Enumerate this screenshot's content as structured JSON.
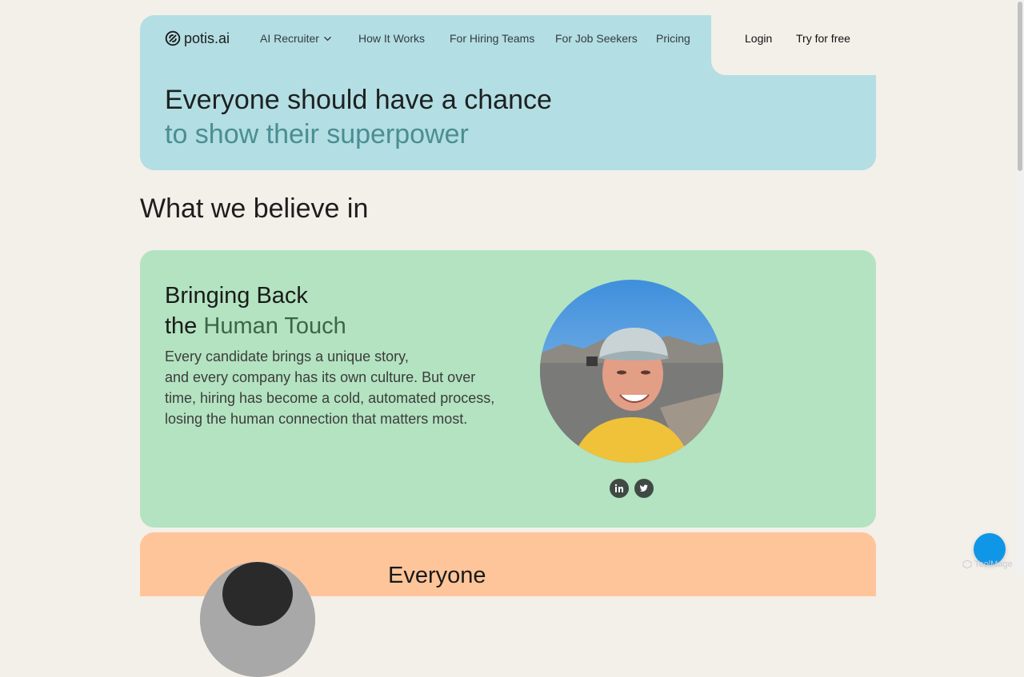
{
  "brand": {
    "name": "potis.ai",
    "icon": "potis-logo-icon"
  },
  "nav": {
    "links": [
      {
        "label": "AI Recruiter",
        "has_dropdown": true
      },
      {
        "label": "How It Works"
      },
      {
        "label": "For Hiring Teams"
      },
      {
        "label": "For Job Seekers"
      },
      {
        "label": "Pricing"
      }
    ],
    "login_label": "Login",
    "cta_label": "Try for free"
  },
  "hero": {
    "title": "Everyone should have a chance",
    "subtitle": "to show their superpower"
  },
  "beliefs": {
    "heading": "What we believe in",
    "cards": [
      {
        "title_line1": "Bringing Back",
        "title_prefix": "the ",
        "title_accent": "Human Touch",
        "body_lines": [
          "Every candidate brings a unique story,",
          "and every company has its own culture. But over",
          "time, hiring has become a cold, automated process,",
          "losing the human connection that matters most."
        ],
        "socials": [
          "linkedin-icon",
          "twitter-icon"
        ]
      },
      {
        "title_partial": "Everyone"
      }
    ]
  },
  "widgets": {
    "chat_icon": "chat-bubble-icon",
    "watermark": "ToolMage"
  },
  "colors": {
    "page_bg": "#f3efe9",
    "hero_bg": "#b3dee3",
    "hero_accent": "#4a8e93",
    "green_card": "#b3e3c0",
    "green_accent": "#3c6648",
    "orange_card": "#fec59a",
    "chat_button": "#0f96e6"
  }
}
